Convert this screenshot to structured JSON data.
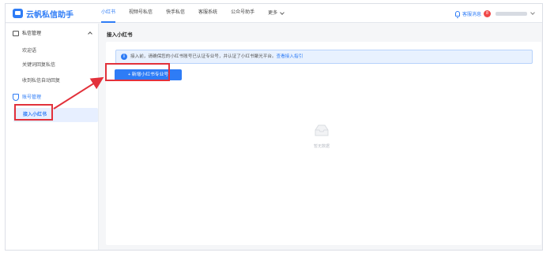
{
  "app": {
    "logo_text": "云帆私信助手"
  },
  "nav": {
    "items": [
      {
        "label": "小红书"
      },
      {
        "label": "视频号私信"
      },
      {
        "label": "快手私信"
      },
      {
        "label": "客服系统"
      },
      {
        "label": "公众号助手"
      }
    ],
    "more_label": "更多",
    "active_index": 0
  },
  "header": {
    "messages_label": "客服消息",
    "messages_badge": "8"
  },
  "sidebar": {
    "group1": {
      "label": "私信管理",
      "items": [
        "欢迎语",
        "关键词回复私信",
        "收到私信自动回复"
      ]
    },
    "group2": {
      "label": "账号管理",
      "active_item": "接入小红书"
    }
  },
  "main": {
    "title": "接入小红书",
    "notice": {
      "text": "接入前，请确保您的小红书账号已认证专业号，并认证了小红书聚光平台。",
      "link": "查看接入指引"
    },
    "add_button_label": "+ 新增小红书专业号",
    "empty_text": "暂无数据"
  },
  "colors": {
    "accent": "#2e7cf6",
    "highlight": "#e2313b",
    "badge": "#f04848"
  },
  "icons": {
    "logo": "logo-icon",
    "bell": "bell-icon",
    "message": "message-icon",
    "shield": "shield-icon",
    "info": "info-icon",
    "empty": "empty-inbox-icon"
  }
}
